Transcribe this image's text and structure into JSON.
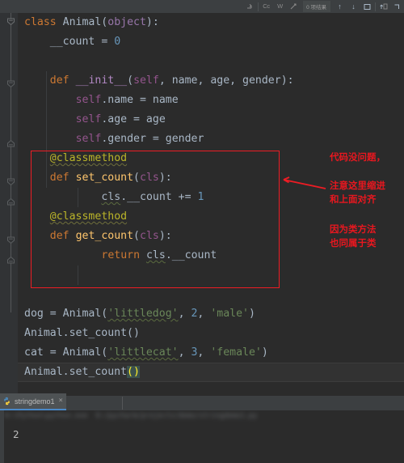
{
  "toolbar": {
    "regex_icon": "regex-icon",
    "match_case_label": "Cc",
    "words_label": "W",
    "filter_icon": "filter-icon",
    "result_count": "0 项结果",
    "prev_arrow": "↑",
    "next_arrow": "↓",
    "select_all_icon": "□",
    "open_in_icon": "⇥",
    "close_icon": "⌐"
  },
  "editor": {
    "lines": [
      {
        "n": 1,
        "indent": 0,
        "tokens": [
          {
            "t": "class",
            "c": "kw"
          },
          {
            "t": " ",
            "c": "plain"
          },
          {
            "t": "Animal",
            "c": "cls"
          },
          {
            "t": "(",
            "c": "paren"
          },
          {
            "t": "object",
            "c": "obj"
          },
          {
            "t": "):",
            "c": "paren"
          }
        ]
      },
      {
        "n": 2,
        "indent": 1,
        "tokens": [
          {
            "t": "__count",
            "c": "plain"
          },
          {
            "t": " = ",
            "c": "plain"
          },
          {
            "t": "0",
            "c": "num"
          }
        ]
      },
      {
        "n": 3,
        "indent": 0,
        "tokens": []
      },
      {
        "n": 4,
        "indent": 1,
        "tokens": [
          {
            "t": "def",
            "c": "kw"
          },
          {
            "t": " ",
            "c": "plain"
          },
          {
            "t": "__init__",
            "c": "magenta"
          },
          {
            "t": "(",
            "c": "paren"
          },
          {
            "t": "self",
            "c": "self"
          },
          {
            "t": ", name, age, gender",
            "c": "plain"
          },
          {
            "t": "):",
            "c": "paren"
          }
        ]
      },
      {
        "n": 5,
        "indent": 2,
        "tokens": [
          {
            "t": "self",
            "c": "self"
          },
          {
            "t": ".name = name",
            "c": "plain"
          }
        ]
      },
      {
        "n": 6,
        "indent": 2,
        "tokens": [
          {
            "t": "self",
            "c": "self"
          },
          {
            "t": ".age = age",
            "c": "plain"
          }
        ]
      },
      {
        "n": 7,
        "indent": 2,
        "tokens": [
          {
            "t": "self",
            "c": "self"
          },
          {
            "t": ".gender = gender",
            "c": "plain"
          }
        ]
      },
      {
        "n": 8,
        "indent": 1,
        "tokens": [
          {
            "t": "@classmethod",
            "c": "dec squiggle"
          }
        ]
      },
      {
        "n": 9,
        "indent": 1,
        "tokens": [
          {
            "t": "def",
            "c": "kw"
          },
          {
            "t": " ",
            "c": "plain"
          },
          {
            "t": "set_count",
            "c": "fn"
          },
          {
            "t": "(",
            "c": "paren"
          },
          {
            "t": "cls",
            "c": "self"
          },
          {
            "t": "):",
            "c": "paren"
          }
        ]
      },
      {
        "n": 10,
        "indent": 3,
        "tokens": [
          {
            "t": "cls",
            "c": "plain squiggle-g"
          },
          {
            "t": ".__count += ",
            "c": "plain"
          },
          {
            "t": "1",
            "c": "num"
          }
        ]
      },
      {
        "n": 11,
        "indent": 1,
        "tokens": [
          {
            "t": "@classmethod",
            "c": "dec squiggle"
          }
        ]
      },
      {
        "n": 12,
        "indent": 1,
        "tokens": [
          {
            "t": "def",
            "c": "kw"
          },
          {
            "t": " ",
            "c": "plain"
          },
          {
            "t": "get_count",
            "c": "fn"
          },
          {
            "t": "(",
            "c": "paren"
          },
          {
            "t": "cls",
            "c": "self"
          },
          {
            "t": "):",
            "c": "paren"
          }
        ]
      },
      {
        "n": 13,
        "indent": 3,
        "tokens": [
          {
            "t": "return",
            "c": "kw"
          },
          {
            "t": " ",
            "c": "plain"
          },
          {
            "t": "cls",
            "c": "plain squiggle-g"
          },
          {
            "t": ".__count",
            "c": "plain"
          }
        ]
      },
      {
        "n": 14,
        "indent": 0,
        "tokens": []
      },
      {
        "n": 15,
        "indent": 0,
        "tokens": []
      },
      {
        "n": 16,
        "indent": 0,
        "tokens": [
          {
            "t": "dog = ",
            "c": "plain"
          },
          {
            "t": "Animal",
            "c": "plain"
          },
          {
            "t": "(",
            "c": "paren"
          },
          {
            "t": "'littledog'",
            "c": "str squiggle-g"
          },
          {
            "t": ", ",
            "c": "plain"
          },
          {
            "t": "2",
            "c": "num"
          },
          {
            "t": ", ",
            "c": "plain"
          },
          {
            "t": "'male'",
            "c": "str"
          },
          {
            "t": ")",
            "c": "paren"
          }
        ]
      },
      {
        "n": 17,
        "indent": 0,
        "tokens": [
          {
            "t": "Animal.set_count()",
            "c": "plain"
          }
        ]
      },
      {
        "n": 18,
        "indent": 0,
        "tokens": [
          {
            "t": "cat = ",
            "c": "plain"
          },
          {
            "t": "Animal",
            "c": "plain"
          },
          {
            "t": "(",
            "c": "paren"
          },
          {
            "t": "'littlecat'",
            "c": "str squiggle-g"
          },
          {
            "t": ", ",
            "c": "plain"
          },
          {
            "t": "3",
            "c": "num"
          },
          {
            "t": ", ",
            "c": "plain"
          },
          {
            "t": "'female'",
            "c": "str"
          },
          {
            "t": ")",
            "c": "paren"
          }
        ]
      },
      {
        "n": 19,
        "indent": 0,
        "tokens": [
          {
            "t": "Animal.set_count",
            "c": "plain"
          },
          {
            "t": "()",
            "c": "caret-hl"
          }
        ]
      }
    ]
  },
  "annotations": {
    "note_1": "代码没问题，",
    "note_2": "注意这里缩进\n和上面对齐",
    "note_3": "因为类方法\n也同属于类",
    "box_color": "#ED1C24"
  },
  "console": {
    "tab_label": "stringdemo1",
    "tab_close": "×",
    "command_line": "D:\\Python\\python.exe  D:/pycharm/projects/demo/stringdemo1.py",
    "output": "2"
  }
}
